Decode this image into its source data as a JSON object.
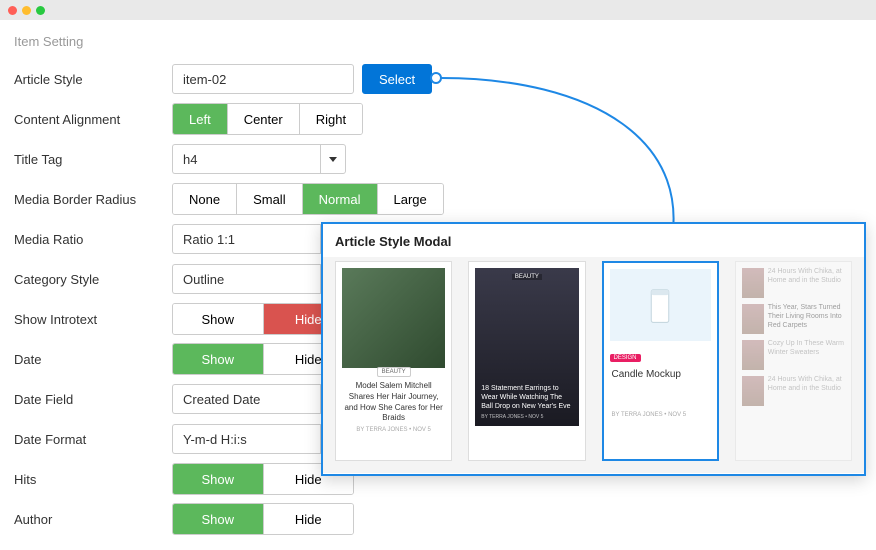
{
  "section_title": "Item Setting",
  "fields": {
    "article_style": {
      "label": "Article Style",
      "value": "item-02",
      "select_btn": "Select"
    },
    "content_alignment": {
      "label": "Content Alignment",
      "left": "Left",
      "center": "Center",
      "right": "Right"
    },
    "title_tag": {
      "label": "Title Tag",
      "value": "h4"
    },
    "media_border_radius": {
      "label": "Media Border Radius",
      "none": "None",
      "small": "Small",
      "normal": "Normal",
      "large": "Large"
    },
    "media_ratio": {
      "label": "Media Ratio",
      "value": "Ratio 1:1"
    },
    "category_style": {
      "label": "Category Style",
      "value": "Outline"
    },
    "show_introtext": {
      "label": "Show Introtext",
      "show": "Show",
      "hide": "Hide"
    },
    "date": {
      "label": "Date",
      "show": "Show",
      "hide": "Hide"
    },
    "date_field": {
      "label": "Date Field",
      "value": "Created Date"
    },
    "date_format": {
      "label": "Date Format",
      "value": "Y-m-d H:i:s"
    },
    "hits": {
      "label": "Hits",
      "show": "Show",
      "hide": "Hide"
    },
    "author": {
      "label": "Author",
      "show": "Show",
      "hide": "Hide"
    }
  },
  "modal": {
    "title": "Article Style Modal",
    "cards": {
      "c1": {
        "tag": "BEAUTY",
        "headline": "Model Salem Mitchell Shares Her Hair Journey, and How She Cares for Her Braids",
        "meta": "BY TERRA JONES  •  NOV 5"
      },
      "c2": {
        "tag": "BEAUTY",
        "headline": "18 Statement Earrings to Wear While Watching The Ball Drop on New Year's Eve",
        "meta": "BY TERRA JONES  •  NOV 5"
      },
      "c3": {
        "tag": "DESIGN",
        "title": "Candle Mockup",
        "meta": "BY TERRA JONES  •  NOV 5"
      },
      "c4": {
        "i1": "24 Hours With Chika, at Home and in the Studio",
        "i2": "This Year, Stars Turned Their Living Rooms Into Red Carpets",
        "i3": "Cozy Up In These Warm Winter Sweaters",
        "i4": "24 Hours With Chika, at Home and in the Studio"
      }
    }
  }
}
